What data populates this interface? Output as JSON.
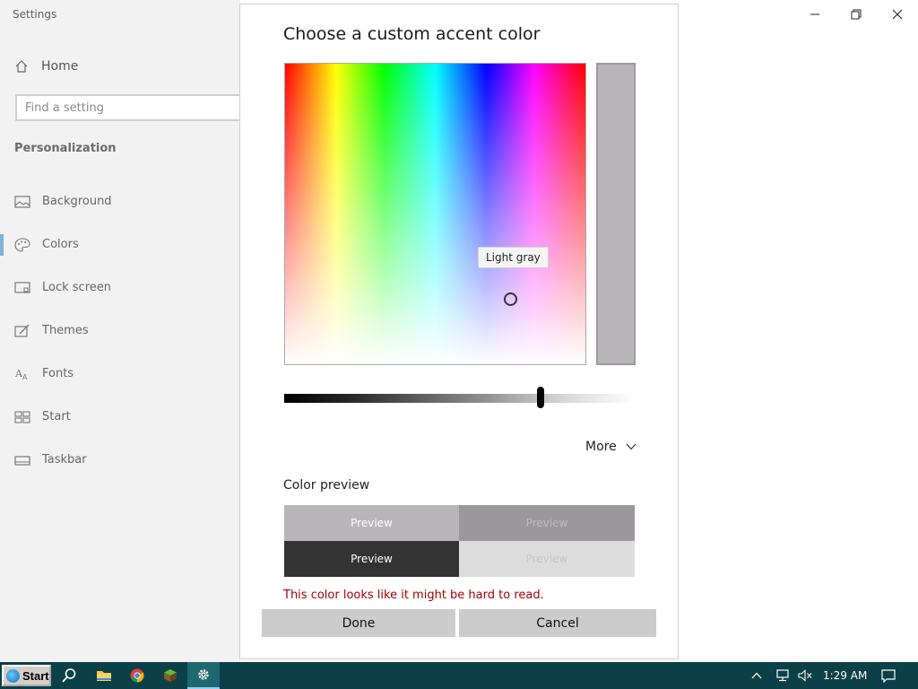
{
  "window": {
    "title": "Settings"
  },
  "sidebar": {
    "home": "Home",
    "search_placeholder": "Find a setting",
    "section": "Personalization",
    "items": [
      {
        "label": "Background",
        "icon": "image-icon"
      },
      {
        "label": "Colors",
        "icon": "palette-icon",
        "active": true
      },
      {
        "label": "Lock screen",
        "icon": "lock-screen-icon"
      },
      {
        "label": "Themes",
        "icon": "brush-icon"
      },
      {
        "label": "Fonts",
        "icon": "fonts-icon"
      },
      {
        "label": "Start",
        "icon": "start-icon"
      },
      {
        "label": "Taskbar",
        "icon": "taskbar-icon"
      }
    ]
  },
  "dialog": {
    "title": "Choose a custom accent color",
    "tooltip": "Light gray",
    "selected_color": "#b9b6ba",
    "brightness_level": 0.73,
    "more": "More",
    "preview_label": "Color preview",
    "previews": [
      {
        "label": "Preview",
        "bg": "#b9b6ba",
        "fg": "#ffffff"
      },
      {
        "label": "Preview",
        "bg": "#9b989c",
        "fg": "#bdbbbd"
      },
      {
        "label": "Preview",
        "bg": "#333333",
        "fg": "#ffffff"
      },
      {
        "label": "Preview",
        "bg": "#dcdcdc",
        "fg": "#c7c7c7"
      }
    ],
    "warning": "This color looks like it might be hard to read.",
    "done": "Done",
    "cancel": "Cancel"
  },
  "taskbar": {
    "start": "Start",
    "time": "1:29 AM",
    "icons": [
      "search-icon",
      "file-explorer-icon",
      "chrome-icon",
      "minecraft-icon",
      "settings-icon"
    ]
  },
  "colors": {
    "taskbar": "#0b4048",
    "accent_indicator": "#7fb3d5",
    "warning": "#a80000"
  }
}
